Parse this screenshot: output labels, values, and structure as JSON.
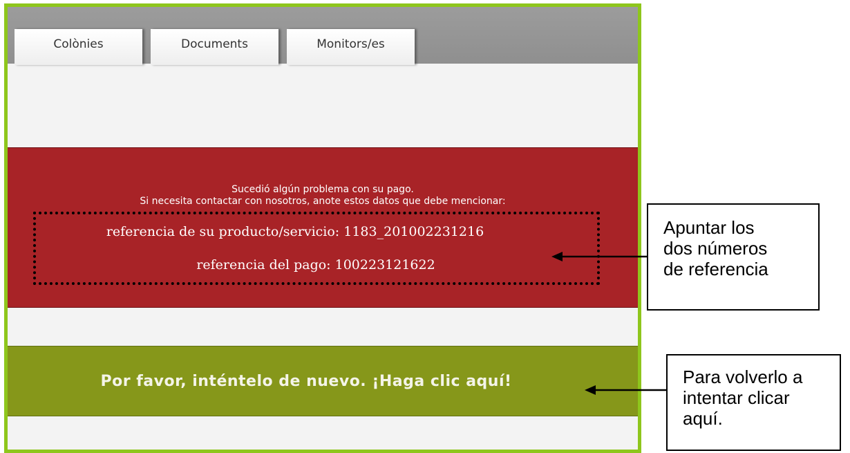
{
  "tabs": [
    {
      "label": "Colònies"
    },
    {
      "label": "Documents"
    },
    {
      "label": "Monitors/es"
    }
  ],
  "error": {
    "line1": "Sucedió algún problema con su pago.",
    "line2": "Si necesita contactar con nosotros, anote estos datos que debe mencionar:",
    "product_ref_label": "referencia de su producto/servicio: ",
    "product_ref_value": "1183_201002231216",
    "payment_ref_label": "referencia del pago: ",
    "payment_ref_value": "100223121622"
  },
  "retry": {
    "label": "Por favor, inténtelo de nuevo. ¡Haga clic aquí!"
  },
  "callouts": [
    {
      "lines": [
        "Apuntar los",
        "dos números",
        "de referencia"
      ]
    },
    {
      "lines": [
        "Para volverlo a",
        "intentar clicar",
        "aquí."
      ]
    }
  ],
  "colors": {
    "frame_border": "#8ec61c",
    "error_band": "#a82327",
    "retry_band": "#86971a",
    "tab_bar": "#999999"
  }
}
